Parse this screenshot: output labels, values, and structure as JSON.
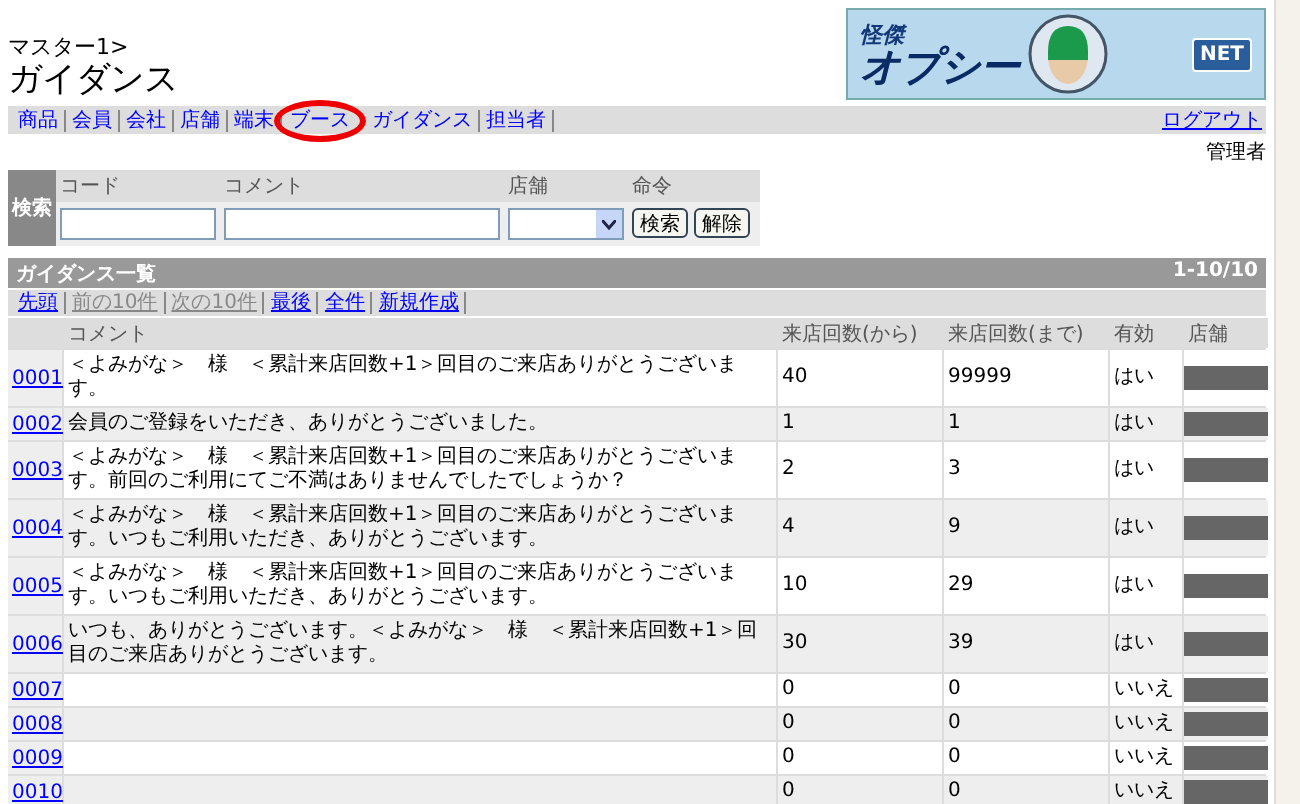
{
  "breadcrumb": "マスター1>",
  "page_title": "ガイダンス",
  "logo": {
    "line_1": "怪傑",
    "line_2": "オプシー",
    "badge": "NET"
  },
  "nav": [
    {
      "label": "商品",
      "highlighted": false
    },
    {
      "label": "会員",
      "highlighted": false
    },
    {
      "label": "会社",
      "highlighted": false
    },
    {
      "label": "店舗",
      "highlighted": false
    },
    {
      "label": "端末",
      "highlighted": false
    },
    {
      "label": "ブース",
      "highlighted": true
    },
    {
      "label": "ガイダンス",
      "highlighted": false
    },
    {
      "label": "担当者",
      "highlighted": false
    }
  ],
  "logout": "ログアウト",
  "user": "管理者",
  "search": {
    "label": "検索",
    "columns": [
      "コード",
      "コメント",
      "店舗",
      "命令"
    ],
    "buttons": [
      "検索",
      "解除"
    ]
  },
  "list": {
    "title": "ガイダンス一覧",
    "range": "1-10/10",
    "pager": [
      {
        "label": "先頭",
        "disabled": false
      },
      {
        "label": "前の10件",
        "disabled": true
      },
      {
        "label": "次の10件",
        "disabled": true
      },
      {
        "label": "最後",
        "disabled": false
      },
      {
        "label": "全件",
        "disabled": false
      },
      {
        "label": "新規作成",
        "disabled": false
      }
    ],
    "columns": [
      "コメント",
      "来店回数(から)",
      "来店回数(まで)",
      "有効",
      "店舗"
    ],
    "rows": [
      {
        "code": "0001",
        "comment": "＜よみがな＞　様　＜累計来店回数+1＞回目のご来店ありがとうございます。",
        "from": "40",
        "to": "99999",
        "valid": "はい"
      },
      {
        "code": "0002",
        "comment": "会員のご登録をいただき、ありがとうございました。",
        "from": "1",
        "to": "1",
        "valid": "はい"
      },
      {
        "code": "0003",
        "comment": "＜よみがな＞　様　＜累計来店回数+1＞回目のご来店ありがとうございます。前回のご利用にてご不満はありませんでしたでしょうか？",
        "from": "2",
        "to": "3",
        "valid": "はい"
      },
      {
        "code": "0004",
        "comment": "＜よみがな＞　様　＜累計来店回数+1＞回目のご来店ありがとうございます。いつもご利用いただき、ありがとうございます。",
        "from": "4",
        "to": "9",
        "valid": "はい"
      },
      {
        "code": "0005",
        "comment": "＜よみがな＞　様　＜累計来店回数+1＞回目のご来店ありがとうございます。いつもご利用いただき、ありがとうございます。",
        "from": "10",
        "to": "29",
        "valid": "はい"
      },
      {
        "code": "0006",
        "comment": "いつも、ありがとうございます。＜よみがな＞　様　＜累計来店回数+1＞回目のご来店ありがとうございます。",
        "from": "30",
        "to": "39",
        "valid": "はい"
      },
      {
        "code": "0007",
        "from": "0",
        "to": "0",
        "valid": "いいえ"
      },
      {
        "code": "0008",
        "from": "0",
        "to": "0",
        "valid": "いいえ"
      },
      {
        "code": "0009",
        "from": "0",
        "to": "0",
        "valid": "いいえ"
      },
      {
        "code": "0010",
        "from": "0",
        "to": "0",
        "valid": "いいえ"
      }
    ]
  }
}
